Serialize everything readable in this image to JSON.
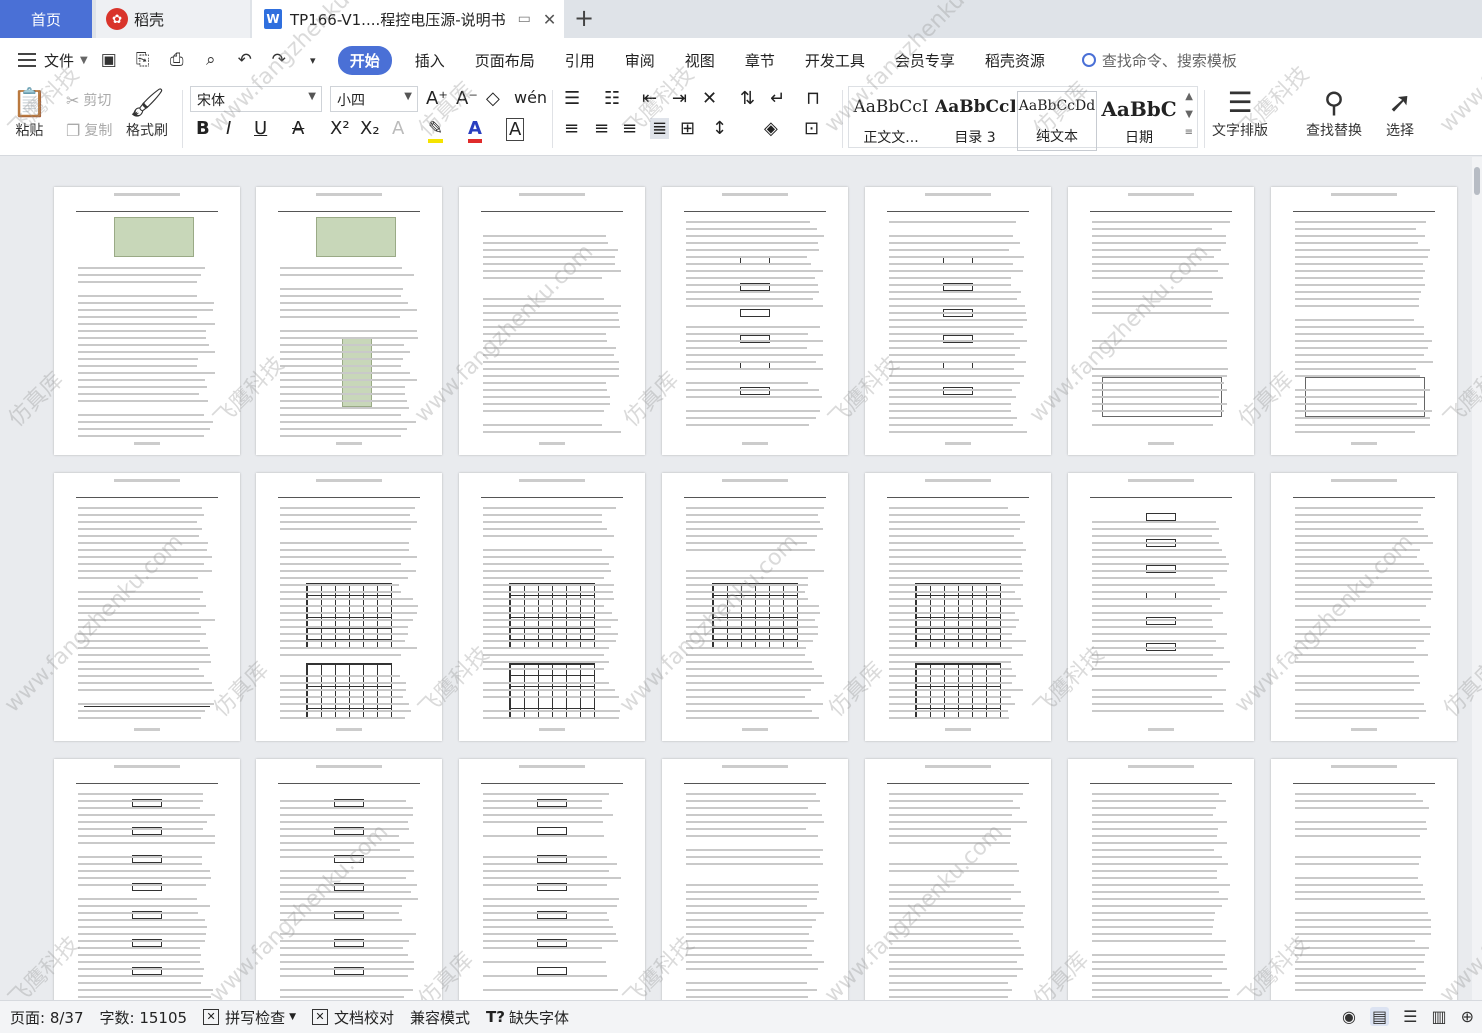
{
  "tabs": {
    "home": "首页",
    "daoke": "稻壳",
    "document": "TP166-V1....程控电压源-说明书"
  },
  "menu": {
    "file": "文件",
    "items": [
      "开始",
      "插入",
      "页面布局",
      "引用",
      "审阅",
      "视图",
      "章节",
      "开发工具",
      "会员专享",
      "稻壳资源"
    ],
    "search_command": "查找命令、搜索模板"
  },
  "ribbon": {
    "paste": "粘贴",
    "cut": "剪切",
    "copy": "复制",
    "format_painter": "格式刷",
    "font_name": "宋体",
    "font_size": "小四",
    "styles": [
      {
        "sample": "AaBbCcI",
        "name": "正文文..."
      },
      {
        "sample": "AaBbCcD",
        "name": "目录 3"
      },
      {
        "sample": "AaBbCcDd",
        "name": "纯文本"
      },
      {
        "sample": "AaBbC",
        "name": "日期"
      }
    ],
    "text_layout": "文字排版",
    "find_replace": "查找替换",
    "select": "选择"
  },
  "status": {
    "page": "页面: 8/37",
    "word_count": "字数: 15105",
    "spell_check": "拼写检查",
    "doc_proof": "文档校对",
    "compat_mode": "兼容模式",
    "missing_fonts": "缺失字体"
  },
  "watermark": {
    "brand": "飞鹰科技",
    "site": "www.fangzhenku.com",
    "brand2": "仿真库"
  },
  "colors": {
    "accent": "#4a70d6",
    "daoke_red": "#d9342b"
  }
}
